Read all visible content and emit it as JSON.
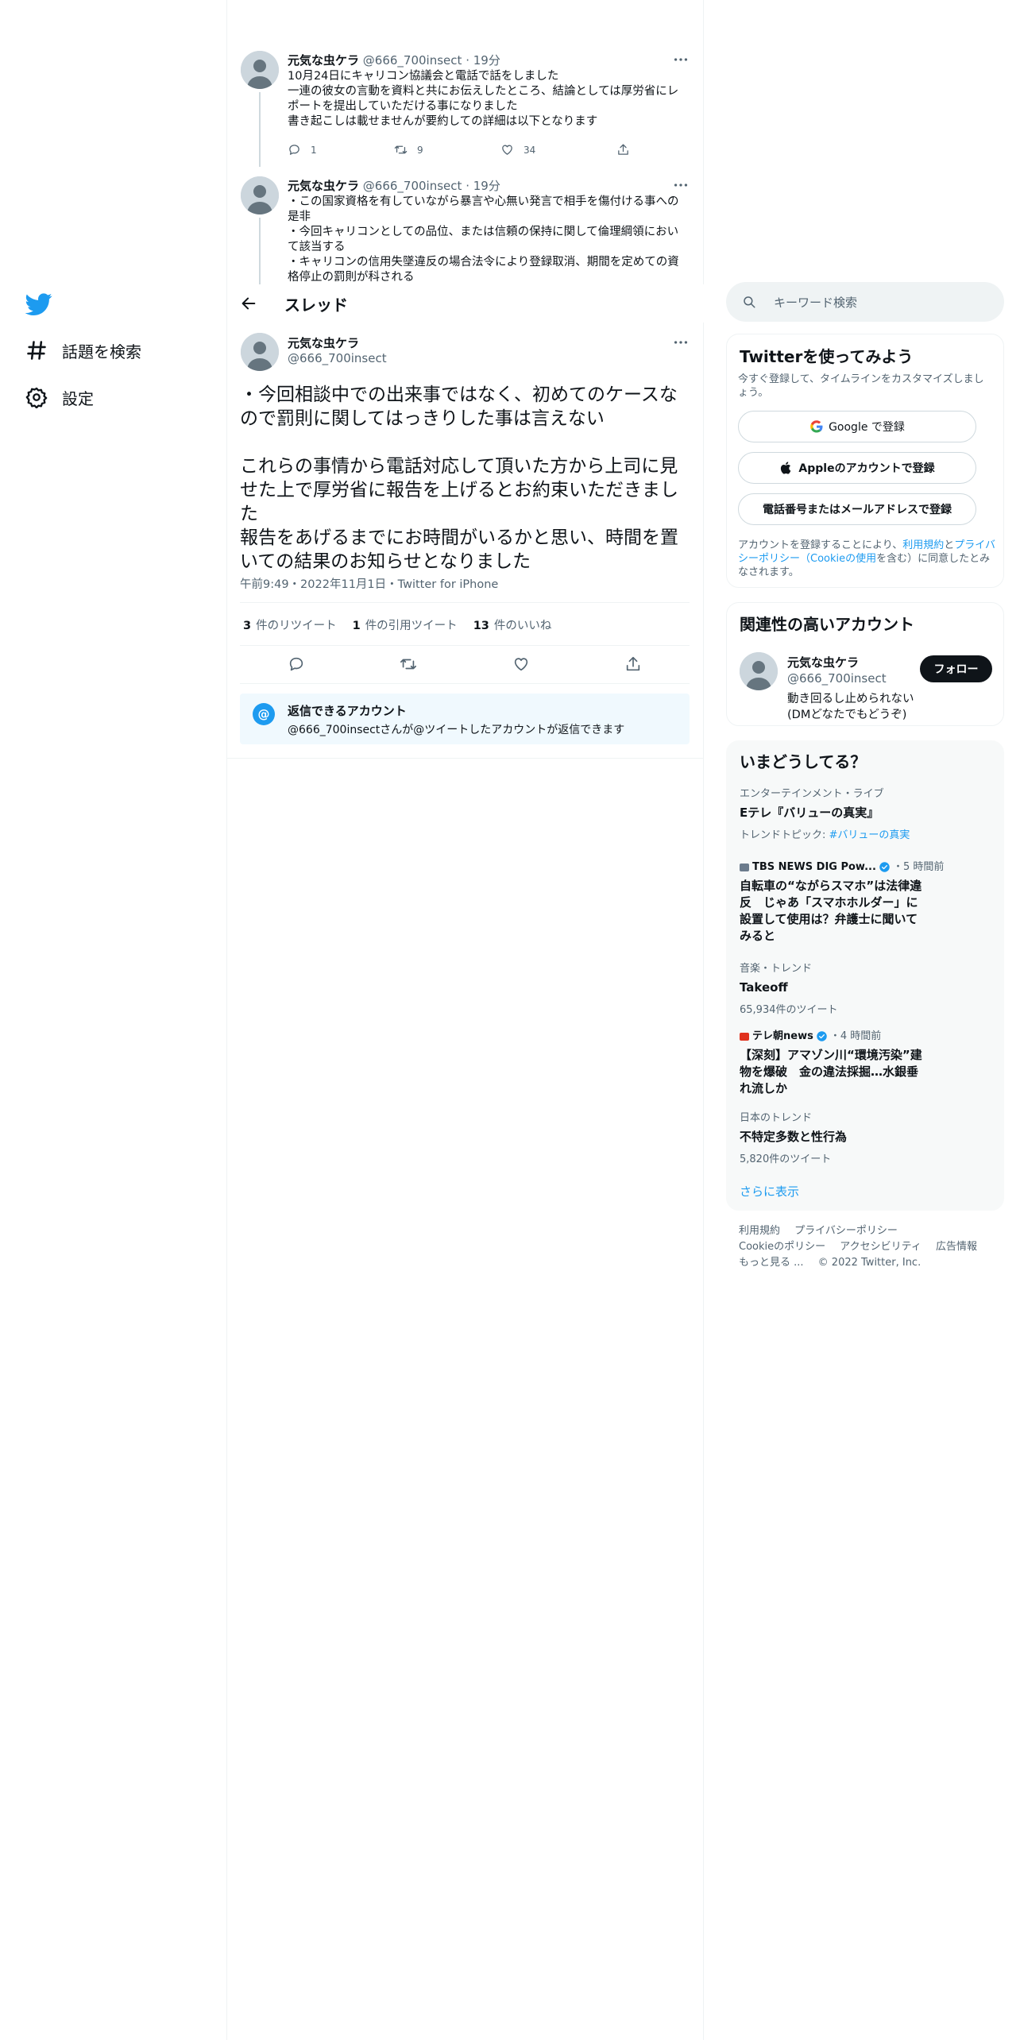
{
  "nav": {
    "explore": "話題を検索",
    "settings": "設定"
  },
  "thread": {
    "title": "スレッド",
    "tweets": [
      {
        "name": "元気な虫ケラ",
        "handle": "@666_700insect",
        "time": "19分",
        "text": "10月24日にキャリコン協議会と電話で話をしました\n一連の彼女の言動を資料と共にお伝えしたところ、結論としては厚労省にレポートを提出していただける事になりました\n書き起こしは載せませんが要約しての詳細は以下となります",
        "replies": "1",
        "retweets": "9",
        "likes": "34"
      },
      {
        "name": "元気な虫ケラ",
        "handle": "@666_700insect",
        "time": "19分",
        "text": "・この国家資格を有していながら暴言や心無い発言で相手を傷付ける事への是非\n・今回キャリコンとしての品位、または信頼の保持に関して倫理綱領において該当する\n・キャリコンの信用失墜違反の場合法令により登録取消、期間を定めての資格停止の罰則が科される"
      }
    ],
    "main": {
      "name": "元気な虫ケラ",
      "handle": "@666_700insect",
      "text": "・今回相談中での出来事ではなく、初めてのケースなので罰則に関してはっきりした事は言えない\n\nこれらの事情から電話対応して頂いた方から上司に見せた上で厚労省に報告を上げるとお約束いただきました\n報告をあげるまでにお時間がいるかと思い、時間を置いての結果のお知らせとなりました",
      "meta": "午前9:49・2022年11月1日・Twitter for iPhone",
      "retweets_count": "3",
      "retweets_label": "件のリツイート",
      "quotes_count": "1",
      "quotes_label": "件の引用ツイート",
      "likes_count": "13",
      "likes_label": "件のいいね"
    },
    "reply_notice": {
      "title": "返信できるアカウント",
      "text": "@666_700insectさんが@ツイートしたアカウントが返信できます"
    }
  },
  "search": {
    "placeholder": "キーワード検索"
  },
  "signup": {
    "title": "Twitterを使ってみよう",
    "subtitle": "今すぐ登録して、タイムラインをカスタマイズしましょう。",
    "google": "Google で登録",
    "apple": "Appleのアカウントで登録",
    "phone": "電話番号またはメールアドレスで登録",
    "terms_prefix": "アカウントを登録することにより、",
    "terms_link1": "利用規約",
    "terms_and": "と",
    "terms_link2": "プライバシーポリシー（Cookieの使用",
    "terms_suffix": "を含む）に同意したとみなされます。"
  },
  "related": {
    "title": "関連性の高いアカウント",
    "name": "元気な虫ケラ",
    "handle": "@666_700insect",
    "bio": "動き回るし止められない(DMどなたでもどうぞ)",
    "follow": "フォロー"
  },
  "trends": {
    "title": "いまどうしてる？",
    "items": [
      {
        "category": "エンターテインメント・ライブ",
        "title": "Eテレ『バリューの真実』",
        "sub_prefix": "トレンドトピック: ",
        "sub_tag": "#バリューの真実"
      },
      {
        "source": "TBS NEWS DIG Pow...",
        "time": "・5 時間前",
        "title": "自転車の“ながらスマホ”は法律違反　じゃあ「スマホホルダー」に設置して使用は？弁護士に聞いてみると"
      },
      {
        "category": "音楽・トレンド",
        "title": "Takeoff",
        "sub": "65,934件のツイート"
      },
      {
        "source": "テレ朝news",
        "time": "・4 時間前",
        "title": "【深刻】アマゾン川“環境汚染”建物を爆破　金の違法採掘…水銀垂れ流しか"
      },
      {
        "category": "日本のトレンド",
        "title": "不特定多数と性行為",
        "sub": "5,820件のツイート"
      }
    ],
    "show_more": "さらに表示"
  },
  "footer": {
    "links": [
      "利用規約",
      "プライバシーポリシー",
      "Cookieのポリシー",
      "アクセシビリティ",
      "広告情報",
      "もっと見る ..."
    ],
    "copyright": "© 2022 Twitter, Inc."
  },
  "colors": {
    "accent": "#1d9bf0",
    "text": "#0f1419",
    "muted": "#536471",
    "border": "#eff3f4"
  }
}
